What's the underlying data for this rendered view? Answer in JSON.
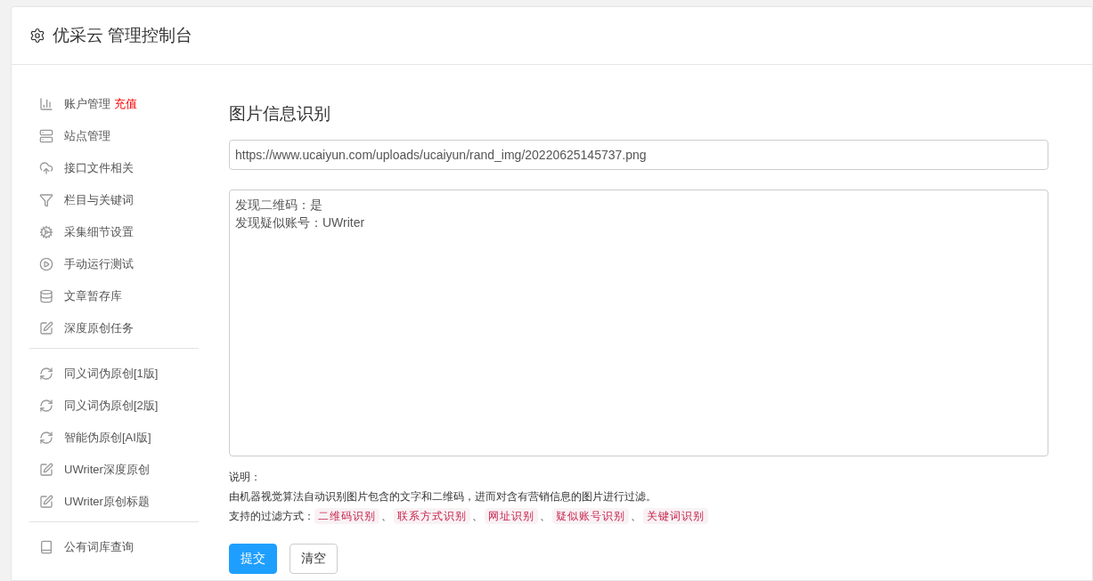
{
  "header": {
    "title": "优采云 管理控制台"
  },
  "sidebar": {
    "groups": [
      {
        "items": [
          {
            "label": "账户管理",
            "badge": "充值"
          },
          {
            "label": "站点管理"
          },
          {
            "label": "接口文件相关"
          },
          {
            "label": "栏目与关键词"
          },
          {
            "label": "采集细节设置"
          },
          {
            "label": "手动运行测试"
          },
          {
            "label": "文章暂存库"
          },
          {
            "label": "深度原创任务"
          }
        ]
      },
      {
        "items": [
          {
            "label": "同义词伪原创[1版]"
          },
          {
            "label": "同义词伪原创[2版]"
          },
          {
            "label": "智能伪原创[AI版]"
          },
          {
            "label": "UWriter深度原创"
          },
          {
            "label": "UWriter原创标题"
          }
        ]
      },
      {
        "items": [
          {
            "label": "公有词库查询"
          }
        ]
      }
    ]
  },
  "main": {
    "heading": "图片信息识别",
    "url_field": {
      "value": "https://www.ucaiyun.com/uploads/ucaiyun/rand_img/20220625145737.png"
    },
    "result_box": {
      "lines": [
        "发现二维码：是",
        "发现疑似账号：UWriter"
      ]
    },
    "notes": {
      "title": "说明：",
      "description": "由机器视觉算法自动识别图片包含的文字和二维码，进而对含有营销信息的图片进行过滤。",
      "methods_label": "支持的过滤方式：",
      "separator": "、",
      "methods": [
        "二维码识别",
        "联系方式识别",
        "网址识别",
        "疑似账号识别",
        "关键词识别"
      ]
    },
    "buttons": [
      {
        "label": "提交",
        "kind": "primary"
      },
      {
        "label": "清空",
        "kind": "default"
      }
    ]
  }
}
